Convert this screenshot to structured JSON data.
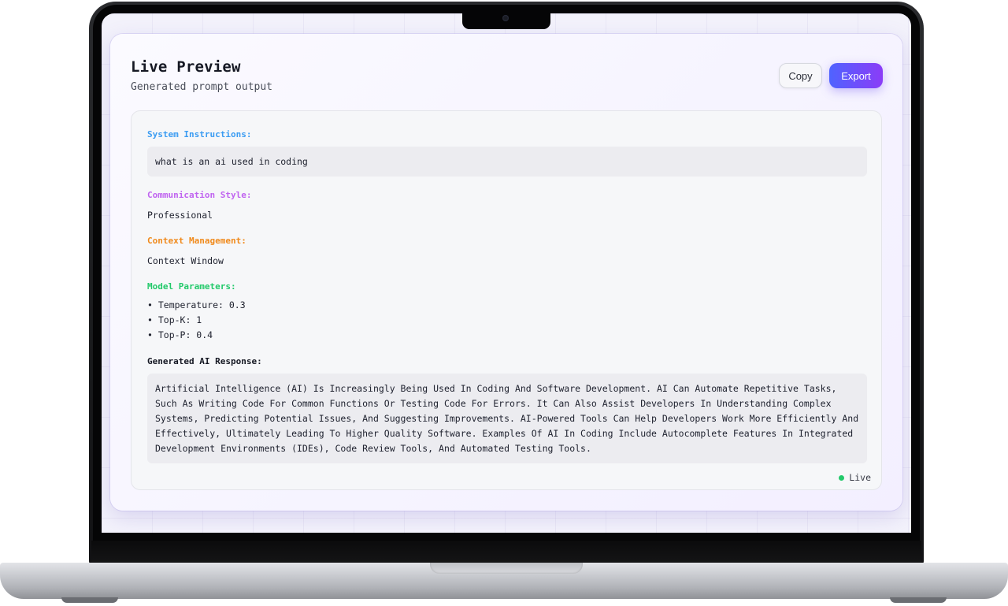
{
  "preview": {
    "title": "Live Preview",
    "subtitle": "Generated prompt output",
    "copy_label": "Copy",
    "export_label": "Export"
  },
  "output": {
    "system_label": "System Instructions:",
    "system_value": "what is an ai used in coding",
    "style_label": "Communication Style:",
    "style_value": "Professional",
    "context_label": "Context Management:",
    "context_value": "Context Window",
    "params_label": "Model Parameters:",
    "params": [
      "• Temperature: 0.3",
      "• Top-K: 1",
      "• Top-P: 0.4"
    ],
    "response_label": "Generated AI Response:",
    "response_text": "Artificial Intelligence (AI) Is Increasingly Being Used In Coding And Software Development. AI Can Automate Repetitive Tasks, Such As Writing Code For Common Functions Or Testing Code For Errors. It Can Also Assist Developers In Understanding Complex Systems, Predicting Potential Issues, And Suggesting Improvements. AI-Powered Tools Can Help Developers Work More Efficiently And Effectively, Ultimately Leading To Higher Quality Software. Examples Of AI In Coding Include Autocomplete Features In Integrated Development Environments (IDEs), Code Review Tools, And Automated Testing Tools.",
    "status_label": "Live"
  },
  "colors": {
    "system_label": "#3b9cf2",
    "style_label": "#c064f0",
    "context_label": "#f08a1c",
    "params_label": "#22c96a",
    "status_dot": "#22c96a",
    "export_gradient_start": "#4f63ff",
    "export_gradient_end": "#8b3cf7"
  }
}
